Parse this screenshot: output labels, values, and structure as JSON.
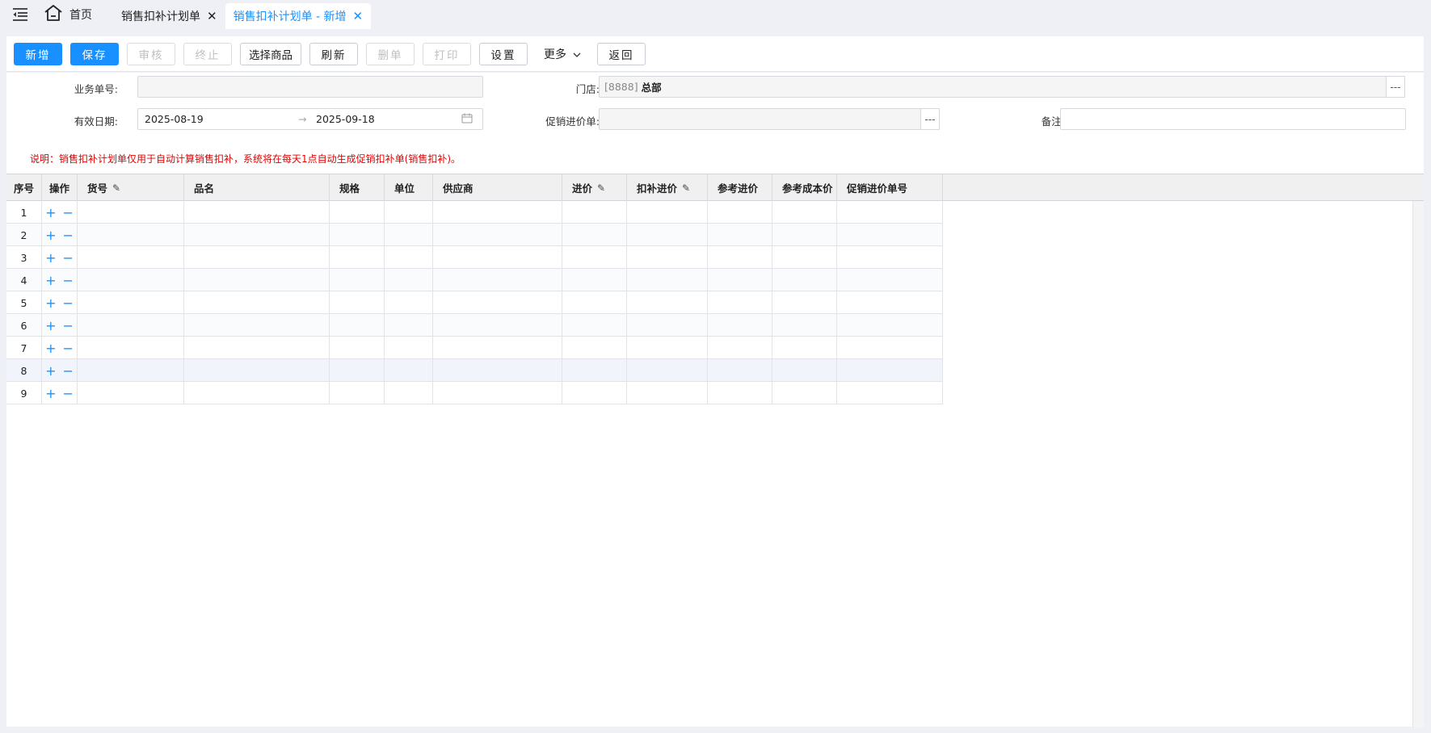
{
  "tabs": {
    "home": "首页",
    "items": [
      {
        "label": "销售扣补计划单"
      },
      {
        "label": "销售扣补计划单 - 新增"
      }
    ]
  },
  "toolbar": {
    "new": "新增",
    "save": "保存",
    "audit": "审核",
    "stop": "终止",
    "select_goods": "选择商品",
    "refresh": "刷新",
    "delete": "删单",
    "print": "打印",
    "settings": "设置",
    "more": "更多",
    "back": "返回"
  },
  "form": {
    "doc_no_label": "业务单号:",
    "doc_no_value": "",
    "store_label": "门店:",
    "store_code": "[8888]",
    "store_name": "总部",
    "valid_label": "有效日期:",
    "date_start": "2025-08-19",
    "date_end": "2025-09-18",
    "promo_label": "促销进价单:",
    "promo_value": "",
    "remark_label": "备注:",
    "remark_value": "",
    "dots": "---"
  },
  "note": "说明：销售扣补计划单仅用于自动计算销售扣补，系统将在每天1点自动生成促销扣补单(销售扣补)。",
  "grid": {
    "columns": [
      "序号",
      "操作",
      "货号",
      "品名",
      "规格",
      "单位",
      "供应商",
      "进价",
      "扣补进价",
      "参考进价",
      "参考成本价",
      "促销进价单号"
    ],
    "rows": [
      "1",
      "2",
      "3",
      "4",
      "5",
      "6",
      "7",
      "8",
      "9"
    ],
    "add_sym": "+",
    "remove_sym": "−"
  },
  "colors": {
    "primary": "#1890ff",
    "note_red": "#e60000"
  }
}
